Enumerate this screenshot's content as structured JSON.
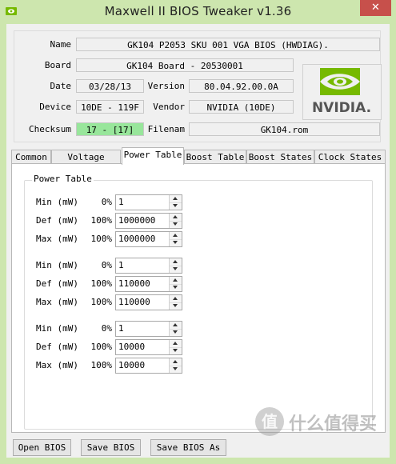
{
  "window": {
    "title": "Maxwell II BIOS Tweaker v1.36",
    "close_glyph": "✕"
  },
  "info": {
    "name_label": "Name",
    "name_value": "GK104 P2053 SKU 001 VGA BIOS (HWDIAG).",
    "board_label": "Board",
    "board_value": "GK104 Board - 20530001",
    "date_label": "Date",
    "date_value": "03/28/13",
    "version_label": "Version",
    "version_value": "80.04.92.00.0A",
    "device_label": "Device",
    "device_value": "10DE - 119F",
    "vendor_label": "Vendor",
    "vendor_value": "NVIDIA (10DE)",
    "checksum_label": "Checksum",
    "checksum_value": "17 - [17]",
    "filename_label": "Filenam",
    "filename_value": "GK104.rom",
    "logo_text": "NVIDIA."
  },
  "tabs": [
    {
      "label": "Common"
    },
    {
      "label": "Voltage Table"
    },
    {
      "label": "Power Table"
    },
    {
      "label": "Boost Table"
    },
    {
      "label": "Boost States"
    },
    {
      "label": "Clock States"
    }
  ],
  "active_tab": "Power Table",
  "power_table": {
    "title": "Power Table",
    "groups": [
      {
        "rows": [
          {
            "label": "Min (mW)",
            "pct": "0%",
            "value": "1"
          },
          {
            "label": "Def (mW)",
            "pct": "100%",
            "value": "1000000"
          },
          {
            "label": "Max (mW)",
            "pct": "100%",
            "value": "1000000"
          }
        ]
      },
      {
        "rows": [
          {
            "label": "Min (mW)",
            "pct": "0%",
            "value": "1"
          },
          {
            "label": "Def (mW)",
            "pct": "100%",
            "value": "110000"
          },
          {
            "label": "Max (mW)",
            "pct": "100%",
            "value": "110000"
          }
        ]
      },
      {
        "rows": [
          {
            "label": "Min (mW)",
            "pct": "0%",
            "value": "1"
          },
          {
            "label": "Def (mW)",
            "pct": "100%",
            "value": "10000"
          },
          {
            "label": "Max (mW)",
            "pct": "100%",
            "value": "10000"
          }
        ]
      }
    ]
  },
  "buttons": {
    "open": "Open BIOS",
    "save": "Save BIOS",
    "save_as": "Save BIOS As"
  },
  "watermark": {
    "text": "什么值得买",
    "icon": "zhi-logo-icon"
  },
  "colors": {
    "frame": "#cde6ae",
    "checksum_ok": "#98e69b",
    "nvidia_green": "#76b900",
    "close": "#c7504b"
  }
}
